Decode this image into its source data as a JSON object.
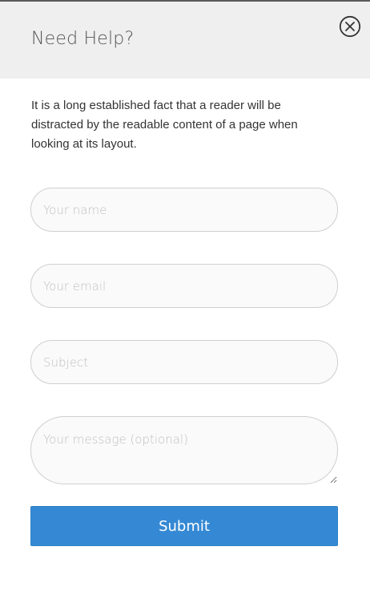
{
  "modal": {
    "title": "Need Help?",
    "description": "It is a long established fact that a reader will be distracted by the readable content of a page when looking at its layout.",
    "close_icon": "close-circle-icon"
  },
  "form": {
    "name_placeholder": "Your name",
    "email_placeholder": "Your email",
    "subject_placeholder": "Subject",
    "message_placeholder": "Your message (optional)",
    "submit_label": "Submit"
  },
  "colors": {
    "header_bg": "#efefef",
    "accent": "#3589d4",
    "field_border": "#cfcfcf"
  }
}
